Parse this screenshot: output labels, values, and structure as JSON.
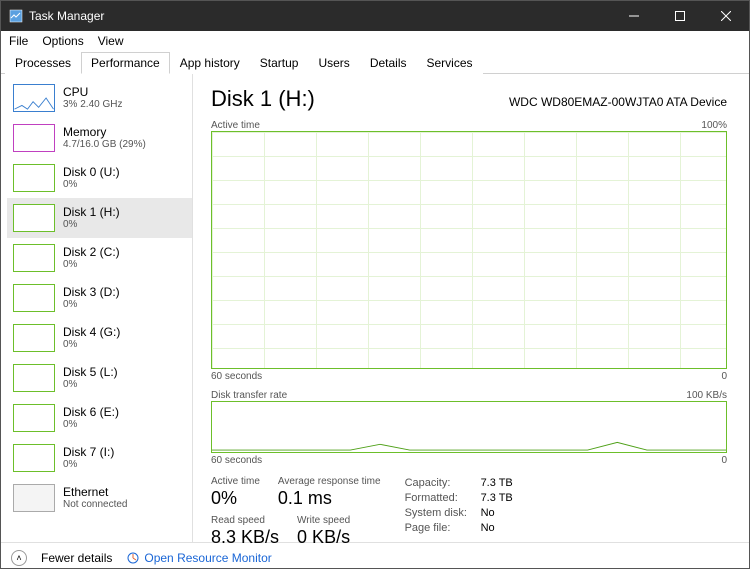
{
  "window": {
    "title": "Task Manager"
  },
  "menu": {
    "file": "File",
    "options": "Options",
    "view": "View"
  },
  "tabs": {
    "processes": "Processes",
    "performance": "Performance",
    "app_history": "App history",
    "startup": "Startup",
    "users": "Users",
    "details": "Details",
    "services": "Services"
  },
  "sidebar": {
    "items": [
      {
        "title": "CPU",
        "sub": "3% 2.40 GHz",
        "style": "blue"
      },
      {
        "title": "Memory",
        "sub": "4.7/16.0 GB (29%)",
        "style": "purple"
      },
      {
        "title": "Disk 0 (U:)",
        "sub": "0%",
        "style": "green"
      },
      {
        "title": "Disk 1 (H:)",
        "sub": "0%",
        "style": "green",
        "selected": true
      },
      {
        "title": "Disk 2 (C:)",
        "sub": "0%",
        "style": "green"
      },
      {
        "title": "Disk 3 (D:)",
        "sub": "0%",
        "style": "green"
      },
      {
        "title": "Disk 4 (G:)",
        "sub": "0%",
        "style": "green"
      },
      {
        "title": "Disk 5 (L:)",
        "sub": "0%",
        "style": "green"
      },
      {
        "title": "Disk 6 (E:)",
        "sub": "0%",
        "style": "green"
      },
      {
        "title": "Disk 7 (I:)",
        "sub": "0%",
        "style": "green"
      },
      {
        "title": "Ethernet",
        "sub": "Not connected",
        "style": "gray"
      }
    ]
  },
  "detail": {
    "title": "Disk 1 (H:)",
    "model": "WDC WD80EMAZ-00WJTA0 ATA Device",
    "chart1": {
      "label": "Active time",
      "max": "100%",
      "xleft": "60 seconds",
      "xright": "0"
    },
    "chart2": {
      "label": "Disk transfer rate",
      "max": "100 KB/s",
      "xleft": "60 seconds",
      "xright": "0"
    },
    "stats": {
      "active_time_lbl": "Active time",
      "active_time": "0%",
      "avg_resp_lbl": "Average response time",
      "avg_resp": "0.1 ms",
      "read_lbl": "Read speed",
      "read": "8.3 KB/s",
      "write_lbl": "Write speed",
      "write": "0 KB/s",
      "capacity_lbl": "Capacity:",
      "capacity": "7.3 TB",
      "formatted_lbl": "Formatted:",
      "formatted": "7.3 TB",
      "sysdisk_lbl": "System disk:",
      "sysdisk": "No",
      "pagefile_lbl": "Page file:",
      "pagefile": "No"
    }
  },
  "footer": {
    "fewer": "Fewer details",
    "resmon": "Open Resource Monitor"
  },
  "chart_data": {
    "type": "line",
    "title": "Disk 1 (H:) Active time",
    "xlabel": "seconds",
    "ylabel": "%",
    "ylim": [
      0,
      100
    ],
    "x_range_seconds": [
      60,
      0
    ],
    "series": [
      {
        "name": "Active time %",
        "values_pct": [
          0,
          0,
          0,
          0,
          0,
          0,
          0,
          0,
          0,
          0,
          0,
          0
        ]
      }
    ],
    "secondary": {
      "type": "line",
      "title": "Disk transfer rate",
      "ylabel": "KB/s",
      "ylim": [
        0,
        100
      ],
      "series": [
        {
          "name": "Transfer KB/s",
          "values_kbps": [
            2,
            2,
            2,
            3,
            2,
            9,
            2,
            2,
            2,
            2,
            12,
            3,
            2,
            2
          ]
        }
      ]
    }
  }
}
